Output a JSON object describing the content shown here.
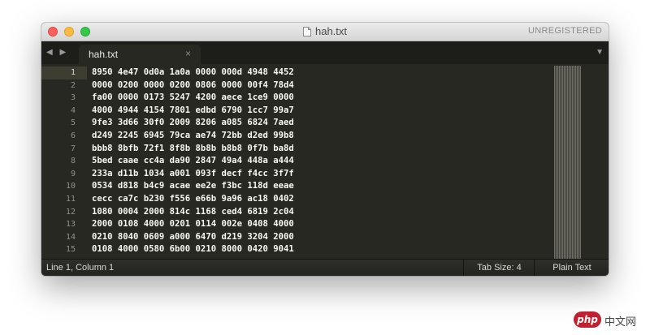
{
  "window": {
    "title": "hah.txt",
    "unregistered": "UNREGISTERED"
  },
  "tabbar": {
    "nav_arrows": "◀ ▶",
    "tab_label": "hah.txt",
    "tab_close": "×",
    "dropdown": "▼"
  },
  "editor": {
    "lines": [
      {
        "num": "1",
        "text": "8950 4e47 0d0a 1a0a 0000 000d 4948 4452"
      },
      {
        "num": "2",
        "text": "0000 0200 0000 0200 0806 0000 00f4 78d4"
      },
      {
        "num": "3",
        "text": "fa00 0000 0173 5247 4200 aece 1ce9 0000"
      },
      {
        "num": "4",
        "text": "4000 4944 4154 7801 edbd 6790 1cc7 99a7"
      },
      {
        "num": "5",
        "text": "9fe3 3d66 30f0 2009 8206 a085 6824 7aed"
      },
      {
        "num": "6",
        "text": "d249 2245 6945 79ca ae74 72bb d2ed 99b8"
      },
      {
        "num": "7",
        "text": "bbb8 8bfb 72f1 8f8b 8b8b b8b8 0f7b ba8d"
      },
      {
        "num": "8",
        "text": "5bed caae cc4a da90 2847 49a4 448a a444"
      },
      {
        "num": "9",
        "text": "233a d11b 1034 a001 093f decf f4cc 3f7f"
      },
      {
        "num": "10",
        "text": "0534 d818 b4c9 acae ee2e f3bc 118d eeae"
      },
      {
        "num": "11",
        "text": "cecc ca7c b230 f556 e66b 9a96 ac18 0402"
      },
      {
        "num": "12",
        "text": "1080 0004 2000 814c 1168 ced4 6819 2c04"
      },
      {
        "num": "13",
        "text": "2000 0108 4000 0201 0114 002e 0408 4000"
      },
      {
        "num": "14",
        "text": "0210 8040 0609 a000 6470 d219 3204 2000"
      },
      {
        "num": "15",
        "text": "0108 4000 0580 6b00 0210 8000 0420 9041"
      }
    ]
  },
  "statusbar": {
    "position": "Line 1, Column 1",
    "tab_size": "Tab Size: 4",
    "syntax": "Plain Text"
  },
  "watermark": {
    "logo": "php",
    "text": "中文网"
  }
}
